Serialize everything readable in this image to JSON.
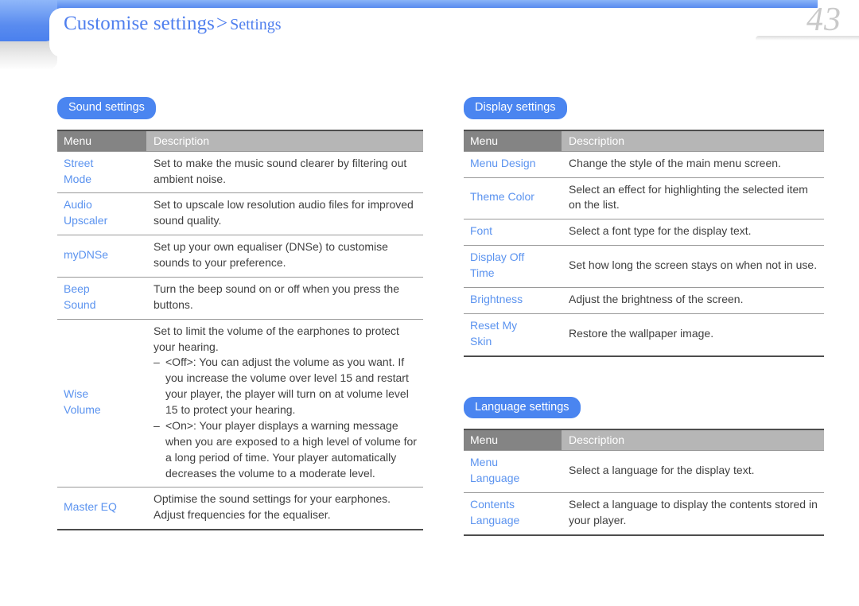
{
  "header": {
    "breadcrumb_main": "Customise settings",
    "breadcrumb_separator": ">",
    "breadcrumb_sub": "Settings",
    "page_number": "43",
    "accent_color": "#4a85f0",
    "breadcrumb_color": "#4f7fee"
  },
  "table_headers": {
    "menu": "Menu",
    "description": "Description"
  },
  "sections": {
    "sound": {
      "pill_label": "Sound settings",
      "rows": [
        {
          "menu": "Street\nMode",
          "description": "Set to make the music sound clearer by filtering out ambient noise."
        },
        {
          "menu": "Audio\nUpscaler",
          "description": "Set to upscale low resolution audio files for improved sound quality."
        },
        {
          "menu": "myDNSe",
          "description": "Set up your own equaliser (DNSe) to customise sounds to your preference."
        },
        {
          "menu": "Beep\nSound",
          "description": "Turn the beep sound on or off when you press the buttons."
        },
        {
          "menu": "Wise\nVolume",
          "description": "Set to limit the volume of the earphones to protect your hearing.",
          "bullets": [
            "<Off>: You can adjust the volume as you want. If you increase the volume over level 15 and restart your player, the player will turn on at volume level 15 to protect your hearing.",
            "<On>: Your player displays a warning message when you are exposed to a high level of volume for a long period of time. Your player automatically decreases the volume to a moderate level."
          ]
        },
        {
          "menu": "Master EQ",
          "description": "Optimise the sound settings for your earphones.\nAdjust frequencies for the equaliser."
        }
      ]
    },
    "display": {
      "pill_label": "Display settings",
      "rows": [
        {
          "menu": "Menu Design",
          "description": "Change the style of the main menu screen."
        },
        {
          "menu": "Theme Color",
          "description": "Select an effect for highlighting the selected item on the list."
        },
        {
          "menu": "Font",
          "description": "Select a font type for the display text."
        },
        {
          "menu": "Display Off\nTime",
          "description": "Set how long the screen stays on when not in use."
        },
        {
          "menu": "Brightness",
          "description": "Adjust the brightness of the screen."
        },
        {
          "menu": "Reset My\nSkin",
          "description": "Restore the wallpaper image."
        }
      ]
    },
    "language": {
      "pill_label": "Language settings",
      "rows": [
        {
          "menu": "Menu\nLanguage",
          "description": "Select a language for the display text."
        },
        {
          "menu": "Contents\nLanguage",
          "description": "Select a language to display the contents stored in your player."
        }
      ]
    }
  }
}
